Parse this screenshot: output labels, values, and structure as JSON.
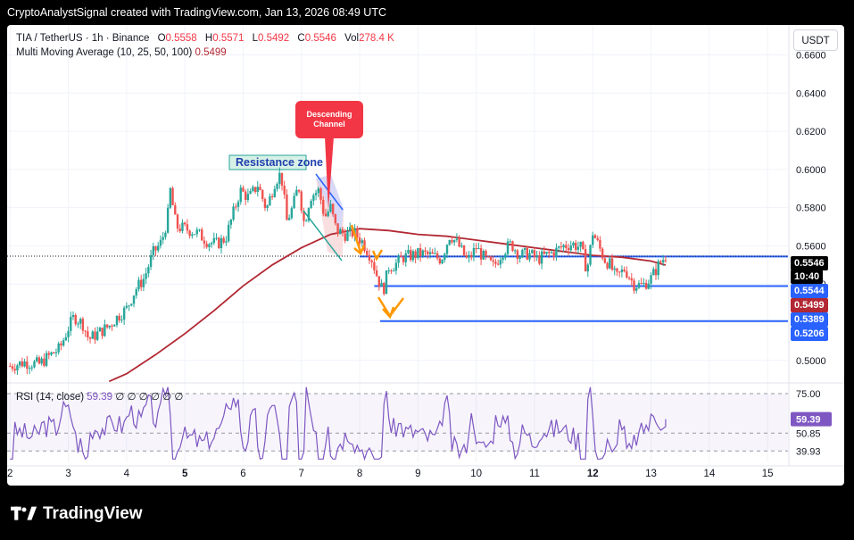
{
  "header": {
    "text": "CryptoAnalystSignal created with TradingView.com, Jan 13, 2026 08:49 UTC"
  },
  "legend": {
    "symbol": "TIA / TetherUS · 1h · Binance",
    "o_label": "O",
    "o_value": "0.5558",
    "h_label": "H",
    "h_value": "0.5571",
    "l_label": "L",
    "l_value": "0.5492",
    "c_label": "C",
    "c_value": "0.5546",
    "vol_label": "Vol",
    "vol_value": "278.4 K",
    "ma_label": "Multi Moving Average (10, 25, 50, 100)",
    "ma_value": "0.5499",
    "rsi_label": "RSI (14, close)",
    "rsi_value": "59.39",
    "rsi_extra": "∅ ∅ ∅ ∅ ∅ ∅"
  },
  "currency_button": "USDT",
  "footer": {
    "brand": "TradingView"
  },
  "chart_data": {
    "type": "candlestick",
    "x_ticks": [
      "2",
      "3",
      "4",
      "5",
      "6",
      "7",
      "8",
      "9",
      "10",
      "11",
      "12",
      "13",
      "14",
      "15"
    ],
    "bold_x_ticks": [
      "5",
      "12"
    ],
    "y_ticks": [
      "0.5000",
      "0.5200",
      "0.5400",
      "0.5600",
      "0.5800",
      "0.6000",
      "0.6200",
      "0.6400",
      "0.6600"
    ],
    "ylim": [
      0.491,
      0.671
    ],
    "xlim": [
      1.95,
      15.35
    ],
    "close_path": [
      [
        2.0,
        0.497
      ],
      [
        2.25,
        0.499
      ],
      [
        2.5,
        0.498
      ],
      [
        2.7,
        0.503
      ],
      [
        2.85,
        0.506
      ],
      [
        3.0,
        0.517
      ],
      [
        3.1,
        0.523
      ],
      [
        3.25,
        0.519
      ],
      [
        3.35,
        0.511
      ],
      [
        3.5,
        0.514
      ],
      [
        3.7,
        0.518
      ],
      [
        3.85,
        0.523
      ],
      [
        4.0,
        0.527
      ],
      [
        4.15,
        0.537
      ],
      [
        4.3,
        0.543
      ],
      [
        4.45,
        0.556
      ],
      [
        4.6,
        0.562
      ],
      [
        4.7,
        0.574
      ],
      [
        4.75,
        0.589
      ],
      [
        4.85,
        0.57
      ],
      [
        5.0,
        0.569
      ],
      [
        5.2,
        0.567
      ],
      [
        5.4,
        0.562
      ],
      [
        5.55,
        0.561
      ],
      [
        5.7,
        0.564
      ],
      [
        5.8,
        0.574
      ],
      [
        5.95,
        0.589
      ],
      [
        6.1,
        0.585
      ],
      [
        6.25,
        0.592
      ],
      [
        6.4,
        0.579
      ],
      [
        6.55,
        0.594
      ],
      [
        6.65,
        0.598
      ],
      [
        6.75,
        0.573
      ],
      [
        6.85,
        0.58
      ],
      [
        6.95,
        0.592
      ],
      [
        7.05,
        0.571
      ],
      [
        7.15,
        0.586
      ],
      [
        7.3,
        0.589
      ],
      [
        7.4,
        0.575
      ],
      [
        7.5,
        0.58
      ],
      [
        7.6,
        0.568
      ],
      [
        7.75,
        0.566
      ],
      [
        7.9,
        0.567
      ],
      [
        8.05,
        0.562
      ],
      [
        8.2,
        0.554
      ],
      [
        8.3,
        0.544
      ],
      [
        8.4,
        0.536
      ],
      [
        8.5,
        0.549
      ],
      [
        8.6,
        0.55
      ],
      [
        8.75,
        0.554
      ],
      [
        8.9,
        0.555
      ],
      [
        9.05,
        0.556
      ],
      [
        9.2,
        0.555
      ],
      [
        9.4,
        0.553
      ],
      [
        9.55,
        0.566
      ],
      [
        9.7,
        0.56
      ],
      [
        9.85,
        0.552
      ],
      [
        10.0,
        0.559
      ],
      [
        10.15,
        0.553
      ],
      [
        10.3,
        0.549
      ],
      [
        10.45,
        0.557
      ],
      [
        10.6,
        0.561
      ],
      [
        10.75,
        0.555
      ],
      [
        10.9,
        0.556
      ],
      [
        11.05,
        0.553
      ],
      [
        11.2,
        0.555
      ],
      [
        11.35,
        0.557
      ],
      [
        11.5,
        0.56
      ],
      [
        11.65,
        0.561
      ],
      [
        11.8,
        0.559
      ],
      [
        11.9,
        0.547
      ],
      [
        12.0,
        0.567
      ],
      [
        12.1,
        0.56
      ],
      [
        12.2,
        0.553
      ],
      [
        12.3,
        0.55
      ],
      [
        12.4,
        0.543
      ],
      [
        12.55,
        0.548
      ],
      [
        12.7,
        0.54
      ],
      [
        12.85,
        0.539
      ],
      [
        13.0,
        0.543
      ],
      [
        13.15,
        0.551
      ],
      [
        13.25,
        0.5546
      ]
    ],
    "ma_path": [
      [
        3.7,
        0.489
      ],
      [
        4.0,
        0.493
      ],
      [
        4.5,
        0.503
      ],
      [
        5.0,
        0.514
      ],
      [
        5.5,
        0.526
      ],
      [
        6.0,
        0.539
      ],
      [
        6.5,
        0.55
      ],
      [
        7.0,
        0.559
      ],
      [
        7.5,
        0.566
      ],
      [
        8.0,
        0.569
      ],
      [
        8.5,
        0.568
      ],
      [
        9.0,
        0.566
      ],
      [
        9.5,
        0.565
      ],
      [
        10.0,
        0.563
      ],
      [
        10.5,
        0.561
      ],
      [
        11.0,
        0.559
      ],
      [
        11.5,
        0.557
      ],
      [
        12.0,
        0.555
      ],
      [
        12.5,
        0.554
      ],
      [
        13.0,
        0.552
      ],
      [
        13.25,
        0.5499
      ]
    ],
    "horizontal_levels": [
      {
        "value": 0.5544,
        "x_start": 8.0
      },
      {
        "value": 0.5389,
        "x_start": 8.25
      },
      {
        "value": 0.5206,
        "x_start": 8.35
      }
    ],
    "price_labels": [
      {
        "text": "0.5546",
        "value": 0.5546,
        "color": "#000000"
      },
      {
        "text": "10:40",
        "value": 0.5546,
        "color": "#000000"
      },
      {
        "text": "0.5544",
        "value": 0.5389,
        "color": "#2962ff"
      },
      {
        "text": "0.5499",
        "value": 0.5499,
        "color": "#b22833"
      },
      {
        "text": "0.5389",
        "value": 0.5206,
        "color": "#2962ff"
      },
      {
        "text": "0.5206",
        "value": 0.5206,
        "color": "#2962ff"
      }
    ],
    "annotations": [
      {
        "text": "Resistance zone"
      },
      {
        "text": "Descending Channel"
      }
    ],
    "rsi": {
      "ticks": [
        "75.00",
        "50.85",
        "39.93"
      ],
      "tick_values": [
        75.0,
        50.85,
        39.93
      ],
      "ylim": [
        33,
        81
      ],
      "current": 59.39,
      "band_upper": 70,
      "band_lower": 30
    },
    "colors": {
      "up": "#26a69a",
      "down": "#ef5350",
      "ma": "#b22833",
      "level": "#2962ff",
      "rsi": "#7e57c2",
      "arrow": "#ff9800"
    }
  }
}
